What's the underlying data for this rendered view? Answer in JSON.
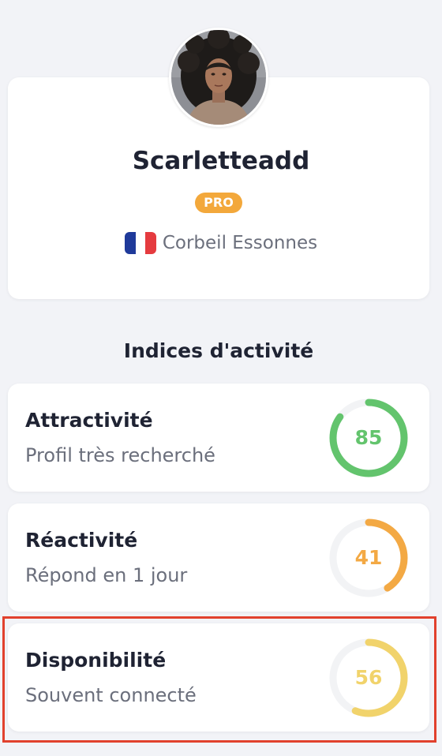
{
  "profile": {
    "username": "Scarletteadd",
    "badge": "PRO",
    "location": "Corbeil Essonnes",
    "flag": "france-flag"
  },
  "activity": {
    "title": "Indices d'activité",
    "metrics": [
      {
        "title": "Attractivité",
        "description": "Profil très recherché",
        "value": "85",
        "progress": 0.85,
        "color": "#63c46d"
      },
      {
        "title": "Réactivité",
        "description": "Répond en 1 jour",
        "value": "41",
        "progress": 0.41,
        "color": "#f3a944"
      },
      {
        "title": "Disponibilité",
        "description": "Souvent connecté",
        "value": "56",
        "progress": 0.56,
        "color": "#f1d36b"
      }
    ]
  },
  "colors": {
    "background": "#f2f3f7",
    "card": "#ffffff",
    "badge": "#f3a83b",
    "highlight": "#e1412d",
    "ring_track": "#f2f3f5"
  }
}
